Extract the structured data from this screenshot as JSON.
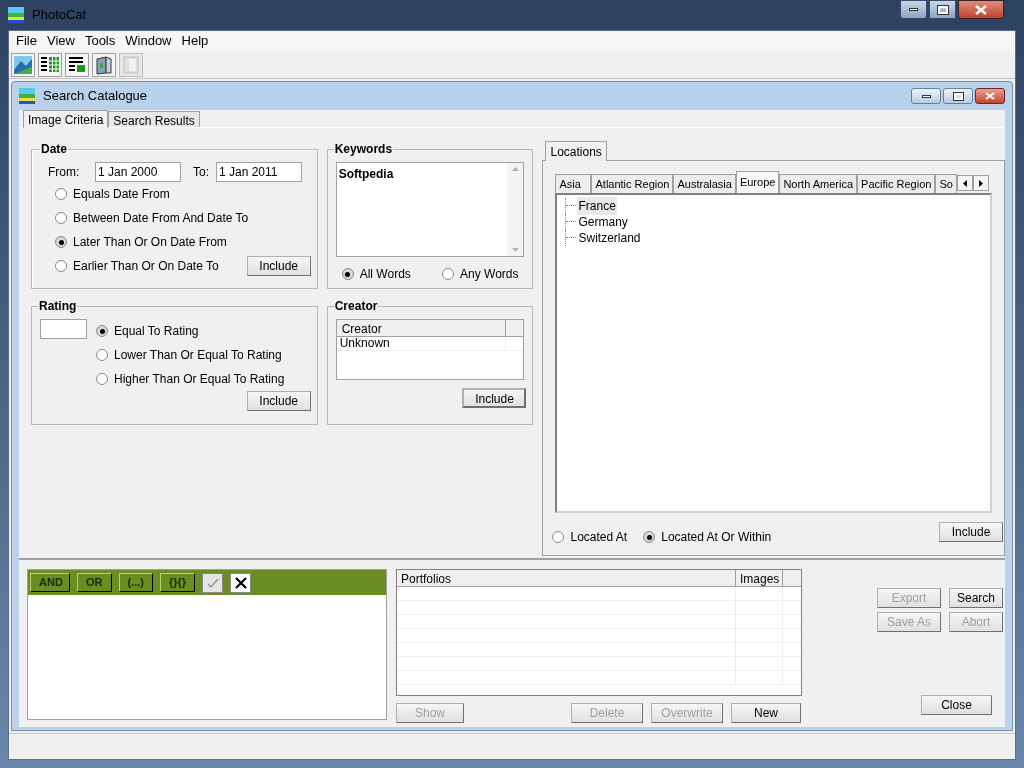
{
  "window": {
    "title": "PhotoCat"
  },
  "menu": [
    "File",
    "View",
    "Tools",
    "Window",
    "Help"
  ],
  "toolbar": [
    {
      "kind": "landscape",
      "disabled": false
    },
    {
      "kind": "grid",
      "disabled": false
    },
    {
      "kind": "list",
      "disabled": false
    },
    {
      "kind": "book",
      "disabled": false
    },
    {
      "kind": "door",
      "disabled": true
    }
  ],
  "child_window": {
    "title": "Search Catalogue"
  },
  "tabs": [
    {
      "label": "Image Criteria",
      "selected": true
    },
    {
      "label": "Search Results",
      "selected": false
    }
  ],
  "date": {
    "title": "Date",
    "from_label": "From:",
    "from": "1 Jan 2000",
    "to_label": "To:",
    "to": "1 Jan 2011",
    "options": [
      {
        "label": "Equals Date From",
        "selected": false
      },
      {
        "label": "Between Date From And Date To",
        "selected": false
      },
      {
        "label": "Later Than Or On Date From",
        "selected": true
      },
      {
        "label": "Earlier Than Or On Date To",
        "selected": false
      }
    ],
    "include": "Include"
  },
  "keywords": {
    "title": "Keywords",
    "value": "Softpedia",
    "options": [
      {
        "label": "All Words",
        "selected": true
      },
      {
        "label": "Any Words",
        "selected": false
      }
    ]
  },
  "rating": {
    "title": "Rating",
    "options": [
      {
        "label": "Equal To Rating",
        "selected": true
      },
      {
        "label": "Lower Than Or Equal To Rating",
        "selected": false
      },
      {
        "label": "Higher Than Or Equal To Rating",
        "selected": false
      }
    ],
    "include": "Include"
  },
  "creator": {
    "title": "Creator",
    "column": "Creator",
    "rows": [
      "Unknown"
    ],
    "include": "Include"
  },
  "locations": {
    "tab": "Locations",
    "regions": [
      {
        "label": "Asia",
        "selected": false
      },
      {
        "label": "Atlantic Region",
        "selected": false
      },
      {
        "label": "Australasia",
        "selected": false
      },
      {
        "label": "Europe",
        "selected": true
      },
      {
        "label": "North America",
        "selected": false
      },
      {
        "label": "Pacific Region",
        "selected": false
      },
      {
        "label": "So",
        "selected": false
      }
    ],
    "tree": [
      {
        "label": "France",
        "selected": true
      },
      {
        "label": "Germany",
        "selected": false
      },
      {
        "label": "Switzerland",
        "selected": false
      }
    ],
    "options": [
      {
        "label": "Located At",
        "selected": false
      },
      {
        "label": "Located At Or Within",
        "selected": true
      }
    ],
    "include": "Include"
  },
  "criteria_buttons": [
    {
      "kind": "text",
      "label": "AND",
      "disabled": false
    },
    {
      "kind": "text",
      "label": "OR",
      "disabled": false
    },
    {
      "kind": "text",
      "label": "(...)",
      "disabled": false
    },
    {
      "kind": "text",
      "label": "{}{}",
      "disabled": false
    },
    {
      "kind": "check",
      "disabled": true
    },
    {
      "kind": "cross",
      "disabled": false
    }
  ],
  "portfolios": {
    "columns": [
      "Portfolios",
      "Images"
    ],
    "buttons": [
      {
        "label": "Show",
        "disabled": true
      },
      {
        "label": "Delete",
        "disabled": true
      },
      {
        "label": "Overwrite",
        "disabled": true
      },
      {
        "label": "New",
        "disabled": false
      }
    ]
  },
  "actions": [
    {
      "label": "Export",
      "disabled": true
    },
    {
      "label": "Search",
      "disabled": false
    },
    {
      "label": "Save As",
      "disabled": true
    },
    {
      "label": "Abort",
      "disabled": true
    },
    {
      "label": "Close",
      "disabled": false
    }
  ]
}
